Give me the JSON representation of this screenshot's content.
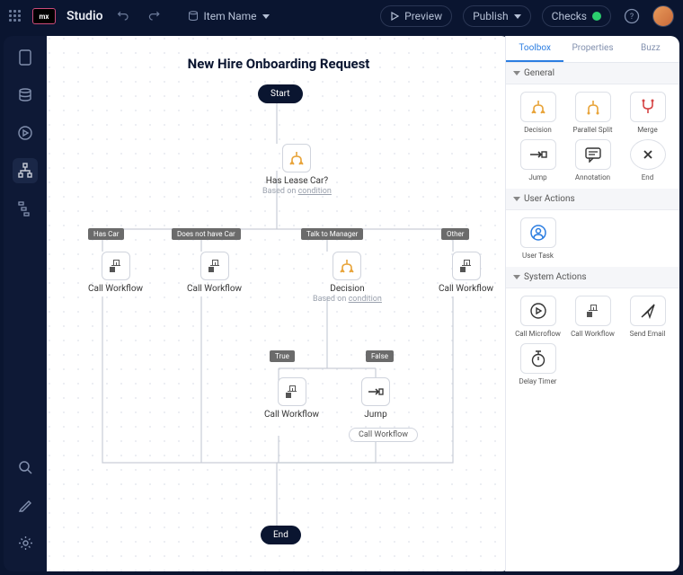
{
  "topbar": {
    "brand": "Studio",
    "logo": "mx",
    "item_name": "Item Name",
    "preview": "Preview",
    "publish": "Publish",
    "checks": "Checks"
  },
  "canvas": {
    "title": "New Hire Onboarding Request",
    "start": "Start",
    "end": "End",
    "n_lease": {
      "label": "Has Lease Car?",
      "sub_prefix": "Based on ",
      "sub_link": "condition"
    },
    "n_decision": {
      "label": "Decision",
      "sub_prefix": "Based on ",
      "sub_link": "condition"
    },
    "b_hascar": "Has Car",
    "b_nocar": "Does not have Car",
    "b_manager": "Talk to Manager",
    "b_other": "Other",
    "b_true": "True",
    "b_false": "False",
    "cw": "Call Workflow",
    "jump": "Jump",
    "jump_pill": "Call Workflow"
  },
  "right": {
    "tabs": {
      "toolbox": "Toolbox",
      "properties": "Properties",
      "buzz": "Buzz"
    },
    "sec_general": "General",
    "sec_user": "User Actions",
    "sec_system": "System Actions",
    "items": {
      "decision": "Decision",
      "psplit": "Parallel Split",
      "merge": "Merge",
      "jump": "Jump",
      "annotation": "Annotation",
      "end": "End",
      "usertask": "User Task",
      "microflow": "Call Microflow",
      "workflow": "Call Workflow",
      "sendemail": "Send Email",
      "timer": "Delay Timer"
    }
  }
}
